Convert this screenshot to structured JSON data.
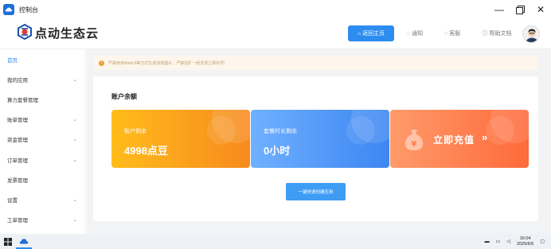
{
  "window": {
    "title": "控制台"
  },
  "header": {
    "brand": "点动生态云",
    "home_label": "返回主页",
    "notify_label": "通知",
    "service_label": "客服",
    "help_label": "帮助文档"
  },
  "sidebar": {
    "items": [
      {
        "label": "首页",
        "active": true,
        "has_children": false
      },
      {
        "label": "我的应用",
        "active": false,
        "has_children": true
      },
      {
        "label": "算力套餐管理",
        "active": false,
        "has_children": false
      },
      {
        "label": "账单管理",
        "active": false,
        "has_children": true
      },
      {
        "label": "资金管理",
        "active": false,
        "has_children": true
      },
      {
        "label": "订单管理",
        "active": false,
        "has_children": true
      },
      {
        "label": "发票管理",
        "active": false,
        "has_children": false
      },
      {
        "label": "设置",
        "active": false,
        "has_children": true
      },
      {
        "label": "工单管理",
        "active": false,
        "has_children": true
      }
    ]
  },
  "notice": {
    "text": "严禁使用WebUI等方式生成违规图片、严禁挖矿一经发现立即封号!"
  },
  "account": {
    "title": "账户余额",
    "balance_label": "账户剩余",
    "balance_value": "4998点豆",
    "time_label": "套餐时长剩余",
    "time_value": "0小时",
    "recharge_label": "立即充值",
    "recharge_arrow": "»",
    "create_button": "一键快速创建应用"
  },
  "taskbar": {
    "time": "16:04",
    "date": "2025/6/5"
  },
  "colors": {
    "accent": "#2d8cf0",
    "balance_card": "#f9a11b",
    "time_card": "#4d92f5",
    "recharge_card": "#ff7a45"
  }
}
